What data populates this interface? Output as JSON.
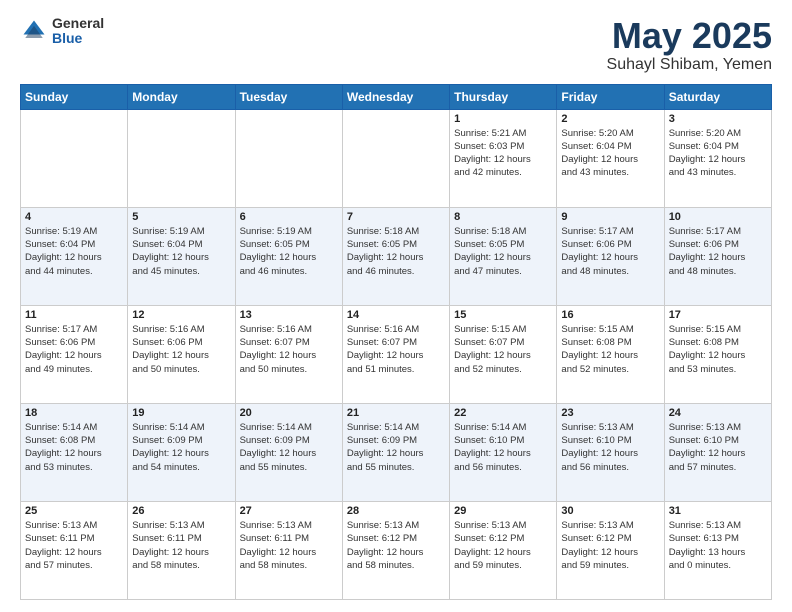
{
  "header": {
    "logo_general": "General",
    "logo_blue": "Blue",
    "title": "May 2025",
    "location": "Suhayl Shibam, Yemen"
  },
  "weekdays": [
    "Sunday",
    "Monday",
    "Tuesday",
    "Wednesday",
    "Thursday",
    "Friday",
    "Saturday"
  ],
  "weeks": [
    [
      {
        "day": "",
        "info": ""
      },
      {
        "day": "",
        "info": ""
      },
      {
        "day": "",
        "info": ""
      },
      {
        "day": "",
        "info": ""
      },
      {
        "day": "1",
        "info": "Sunrise: 5:21 AM\nSunset: 6:03 PM\nDaylight: 12 hours\nand 42 minutes."
      },
      {
        "day": "2",
        "info": "Sunrise: 5:20 AM\nSunset: 6:04 PM\nDaylight: 12 hours\nand 43 minutes."
      },
      {
        "day": "3",
        "info": "Sunrise: 5:20 AM\nSunset: 6:04 PM\nDaylight: 12 hours\nand 43 minutes."
      }
    ],
    [
      {
        "day": "4",
        "info": "Sunrise: 5:19 AM\nSunset: 6:04 PM\nDaylight: 12 hours\nand 44 minutes."
      },
      {
        "day": "5",
        "info": "Sunrise: 5:19 AM\nSunset: 6:04 PM\nDaylight: 12 hours\nand 45 minutes."
      },
      {
        "day": "6",
        "info": "Sunrise: 5:19 AM\nSunset: 6:05 PM\nDaylight: 12 hours\nand 46 minutes."
      },
      {
        "day": "7",
        "info": "Sunrise: 5:18 AM\nSunset: 6:05 PM\nDaylight: 12 hours\nand 46 minutes."
      },
      {
        "day": "8",
        "info": "Sunrise: 5:18 AM\nSunset: 6:05 PM\nDaylight: 12 hours\nand 47 minutes."
      },
      {
        "day": "9",
        "info": "Sunrise: 5:17 AM\nSunset: 6:06 PM\nDaylight: 12 hours\nand 48 minutes."
      },
      {
        "day": "10",
        "info": "Sunrise: 5:17 AM\nSunset: 6:06 PM\nDaylight: 12 hours\nand 48 minutes."
      }
    ],
    [
      {
        "day": "11",
        "info": "Sunrise: 5:17 AM\nSunset: 6:06 PM\nDaylight: 12 hours\nand 49 minutes."
      },
      {
        "day": "12",
        "info": "Sunrise: 5:16 AM\nSunset: 6:06 PM\nDaylight: 12 hours\nand 50 minutes."
      },
      {
        "day": "13",
        "info": "Sunrise: 5:16 AM\nSunset: 6:07 PM\nDaylight: 12 hours\nand 50 minutes."
      },
      {
        "day": "14",
        "info": "Sunrise: 5:16 AM\nSunset: 6:07 PM\nDaylight: 12 hours\nand 51 minutes."
      },
      {
        "day": "15",
        "info": "Sunrise: 5:15 AM\nSunset: 6:07 PM\nDaylight: 12 hours\nand 52 minutes."
      },
      {
        "day": "16",
        "info": "Sunrise: 5:15 AM\nSunset: 6:08 PM\nDaylight: 12 hours\nand 52 minutes."
      },
      {
        "day": "17",
        "info": "Sunrise: 5:15 AM\nSunset: 6:08 PM\nDaylight: 12 hours\nand 53 minutes."
      }
    ],
    [
      {
        "day": "18",
        "info": "Sunrise: 5:14 AM\nSunset: 6:08 PM\nDaylight: 12 hours\nand 53 minutes."
      },
      {
        "day": "19",
        "info": "Sunrise: 5:14 AM\nSunset: 6:09 PM\nDaylight: 12 hours\nand 54 minutes."
      },
      {
        "day": "20",
        "info": "Sunrise: 5:14 AM\nSunset: 6:09 PM\nDaylight: 12 hours\nand 55 minutes."
      },
      {
        "day": "21",
        "info": "Sunrise: 5:14 AM\nSunset: 6:09 PM\nDaylight: 12 hours\nand 55 minutes."
      },
      {
        "day": "22",
        "info": "Sunrise: 5:14 AM\nSunset: 6:10 PM\nDaylight: 12 hours\nand 56 minutes."
      },
      {
        "day": "23",
        "info": "Sunrise: 5:13 AM\nSunset: 6:10 PM\nDaylight: 12 hours\nand 56 minutes."
      },
      {
        "day": "24",
        "info": "Sunrise: 5:13 AM\nSunset: 6:10 PM\nDaylight: 12 hours\nand 57 minutes."
      }
    ],
    [
      {
        "day": "25",
        "info": "Sunrise: 5:13 AM\nSunset: 6:11 PM\nDaylight: 12 hours\nand 57 minutes."
      },
      {
        "day": "26",
        "info": "Sunrise: 5:13 AM\nSunset: 6:11 PM\nDaylight: 12 hours\nand 58 minutes."
      },
      {
        "day": "27",
        "info": "Sunrise: 5:13 AM\nSunset: 6:11 PM\nDaylight: 12 hours\nand 58 minutes."
      },
      {
        "day": "28",
        "info": "Sunrise: 5:13 AM\nSunset: 6:12 PM\nDaylight: 12 hours\nand 58 minutes."
      },
      {
        "day": "29",
        "info": "Sunrise: 5:13 AM\nSunset: 6:12 PM\nDaylight: 12 hours\nand 59 minutes."
      },
      {
        "day": "30",
        "info": "Sunrise: 5:13 AM\nSunset: 6:12 PM\nDaylight: 12 hours\nand 59 minutes."
      },
      {
        "day": "31",
        "info": "Sunrise: 5:13 AM\nSunset: 6:13 PM\nDaylight: 13 hours\nand 0 minutes."
      }
    ]
  ]
}
